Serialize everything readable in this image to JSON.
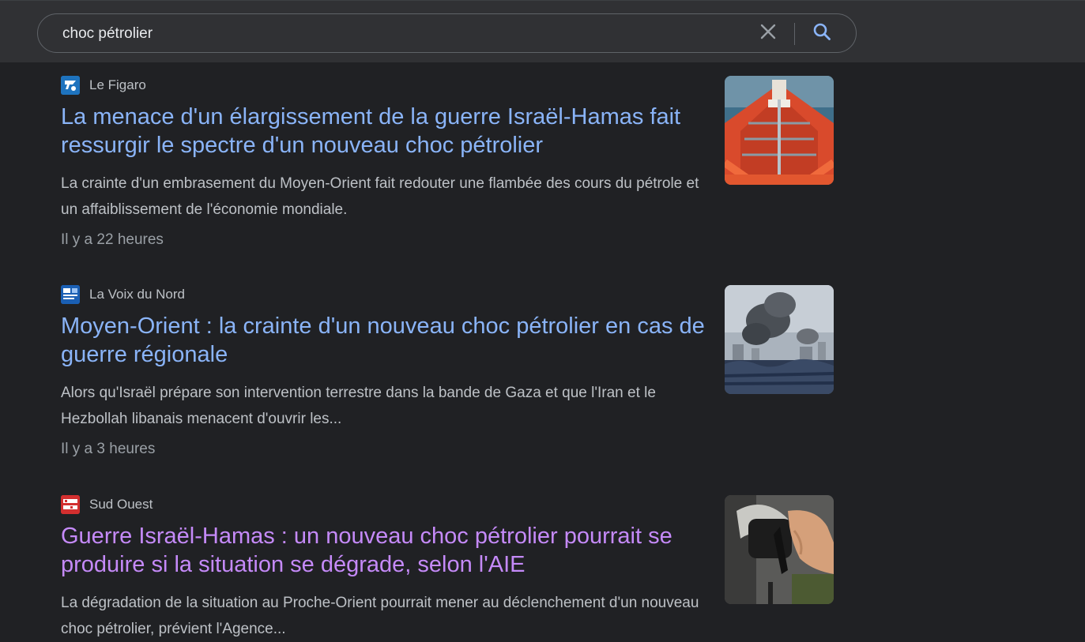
{
  "search": {
    "query": "choc pétrolier",
    "clear_icon": "close-icon",
    "search_icon": "search-icon"
  },
  "results": [
    {
      "source": "Le Figaro",
      "headline": "La menace d'un élargissement de la guerre Israël-Hamas fait ressurgir le spectre d'un nouveau choc pétrolier",
      "snippet": "La crainte d'un embrasement du Moyen-Orient fait redouter une flambée des cours du pétrole et un affaiblissement de l'économie mondiale.",
      "time": "Il y a 22 heures",
      "visited": false
    },
    {
      "source": "La Voix du Nord",
      "headline": "Moyen-Orient : la crainte d'un nouveau choc pétrolier en cas de guerre régionale",
      "snippet": "Alors qu'Israël prépare son intervention terrestre dans la bande de Gaza et que l'Iran et le Hezbollah libanais menacent d'ouvrir les...",
      "time": "Il y a 3 heures",
      "visited": false
    },
    {
      "source": "Sud Ouest",
      "headline": "Guerre Israël-Hamas : un nouveau choc pétrolier pourrait se produire si la situation se dégrade, selon l'AIE",
      "snippet": "La dégradation de la situation au Proche-Orient pourrait mener au déclenchement d'un nouveau choc pétrolier, prévient l'Agence...",
      "time": "",
      "visited": true
    }
  ],
  "colors": {
    "background": "#202124",
    "link": "#8ab4f8",
    "visited_link": "#c58af9",
    "text": "#bdc1c6",
    "muted": "#9aa0a6"
  }
}
